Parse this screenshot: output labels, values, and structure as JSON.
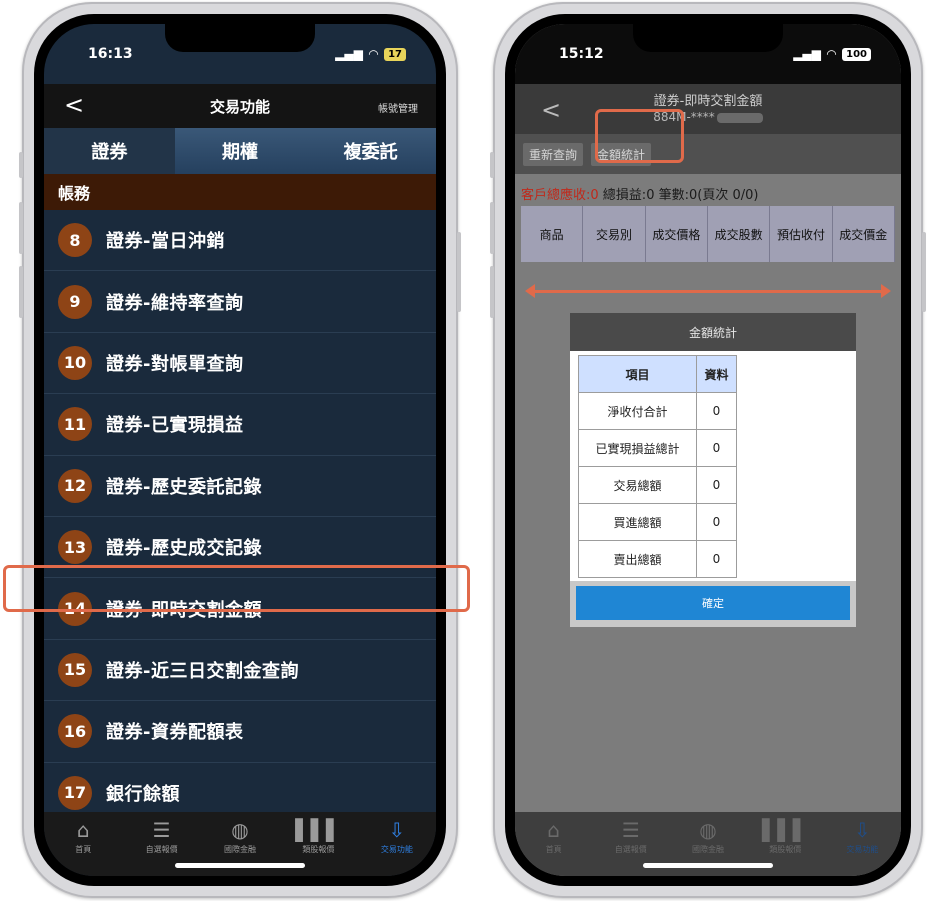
{
  "left_phone": {
    "status": {
      "time": "16:13",
      "battery": "17"
    },
    "navbar": {
      "back": "<",
      "title": "交易功能",
      "right": "帳號管理"
    },
    "tabs": [
      {
        "label": "證券"
      },
      {
        "label": "期權"
      },
      {
        "label": "複委託"
      }
    ],
    "section": "帳務",
    "items": [
      {
        "num": "8",
        "label": "證券-當日沖銷"
      },
      {
        "num": "9",
        "label": "證券-維持率查詢"
      },
      {
        "num": "10",
        "label": "證券-對帳單查詢"
      },
      {
        "num": "11",
        "label": "證券-已實現損益"
      },
      {
        "num": "12",
        "label": "證券-歷史委託記錄"
      },
      {
        "num": "13",
        "label": "證券-歷史成交記錄"
      },
      {
        "num": "14",
        "label": "證券-即時交割金額"
      },
      {
        "num": "15",
        "label": "證券-近三日交割金查詢"
      },
      {
        "num": "16",
        "label": "證券-資券配額表"
      },
      {
        "num": "17",
        "label": "銀行餘額"
      }
    ],
    "tabbar": [
      {
        "label": "首頁",
        "icon": "home-icon"
      },
      {
        "label": "自選報價",
        "icon": "list-icon"
      },
      {
        "label": "國際金融",
        "icon": "globe-icon"
      },
      {
        "label": "類股報價",
        "icon": "chart-icon"
      },
      {
        "label": "交易功能",
        "icon": "trade-icon"
      }
    ]
  },
  "right_phone": {
    "status": {
      "time": "15:12",
      "battery": "100"
    },
    "navbar": {
      "back": "<",
      "title": "證券-即時交割金額",
      "account": "884M-****"
    },
    "toolbar": {
      "refresh": "重新查詢",
      "stats": "金額統計"
    },
    "info": {
      "label1": "客戶總應收:",
      "value1": "0",
      "label2": " 總損益:",
      "value2": "0",
      "label3": " 筆數:",
      "value3": "0",
      "label4": "(頁次 ",
      "value4": "0/0",
      "end": ")"
    },
    "columns": [
      "商品",
      "交易別",
      "成交價格",
      "成交股數",
      "預估收付",
      "成交價金"
    ],
    "dialog": {
      "title": "金額統計",
      "head_item": "項目",
      "head_data": "資料",
      "rows": [
        {
          "item": "淨收付合計",
          "value": "0"
        },
        {
          "item": "已實現損益總計",
          "value": "0"
        },
        {
          "item": "交易總額",
          "value": "0"
        },
        {
          "item": "買進總額",
          "value": "0"
        },
        {
          "item": "賣出總額",
          "value": "0"
        }
      ],
      "ok": "確定"
    },
    "tabbar": [
      {
        "label": "首頁",
        "icon": "home-icon"
      },
      {
        "label": "自選報價",
        "icon": "list-icon"
      },
      {
        "label": "國際金融",
        "icon": "globe-icon"
      },
      {
        "label": "類股報價",
        "icon": "chart-icon"
      },
      {
        "label": "交易功能",
        "icon": "trade-icon"
      }
    ]
  },
  "colors": {
    "highlight": "#e06a4a",
    "accent_blue": "#1f86d4",
    "badge": "#8e4416"
  }
}
